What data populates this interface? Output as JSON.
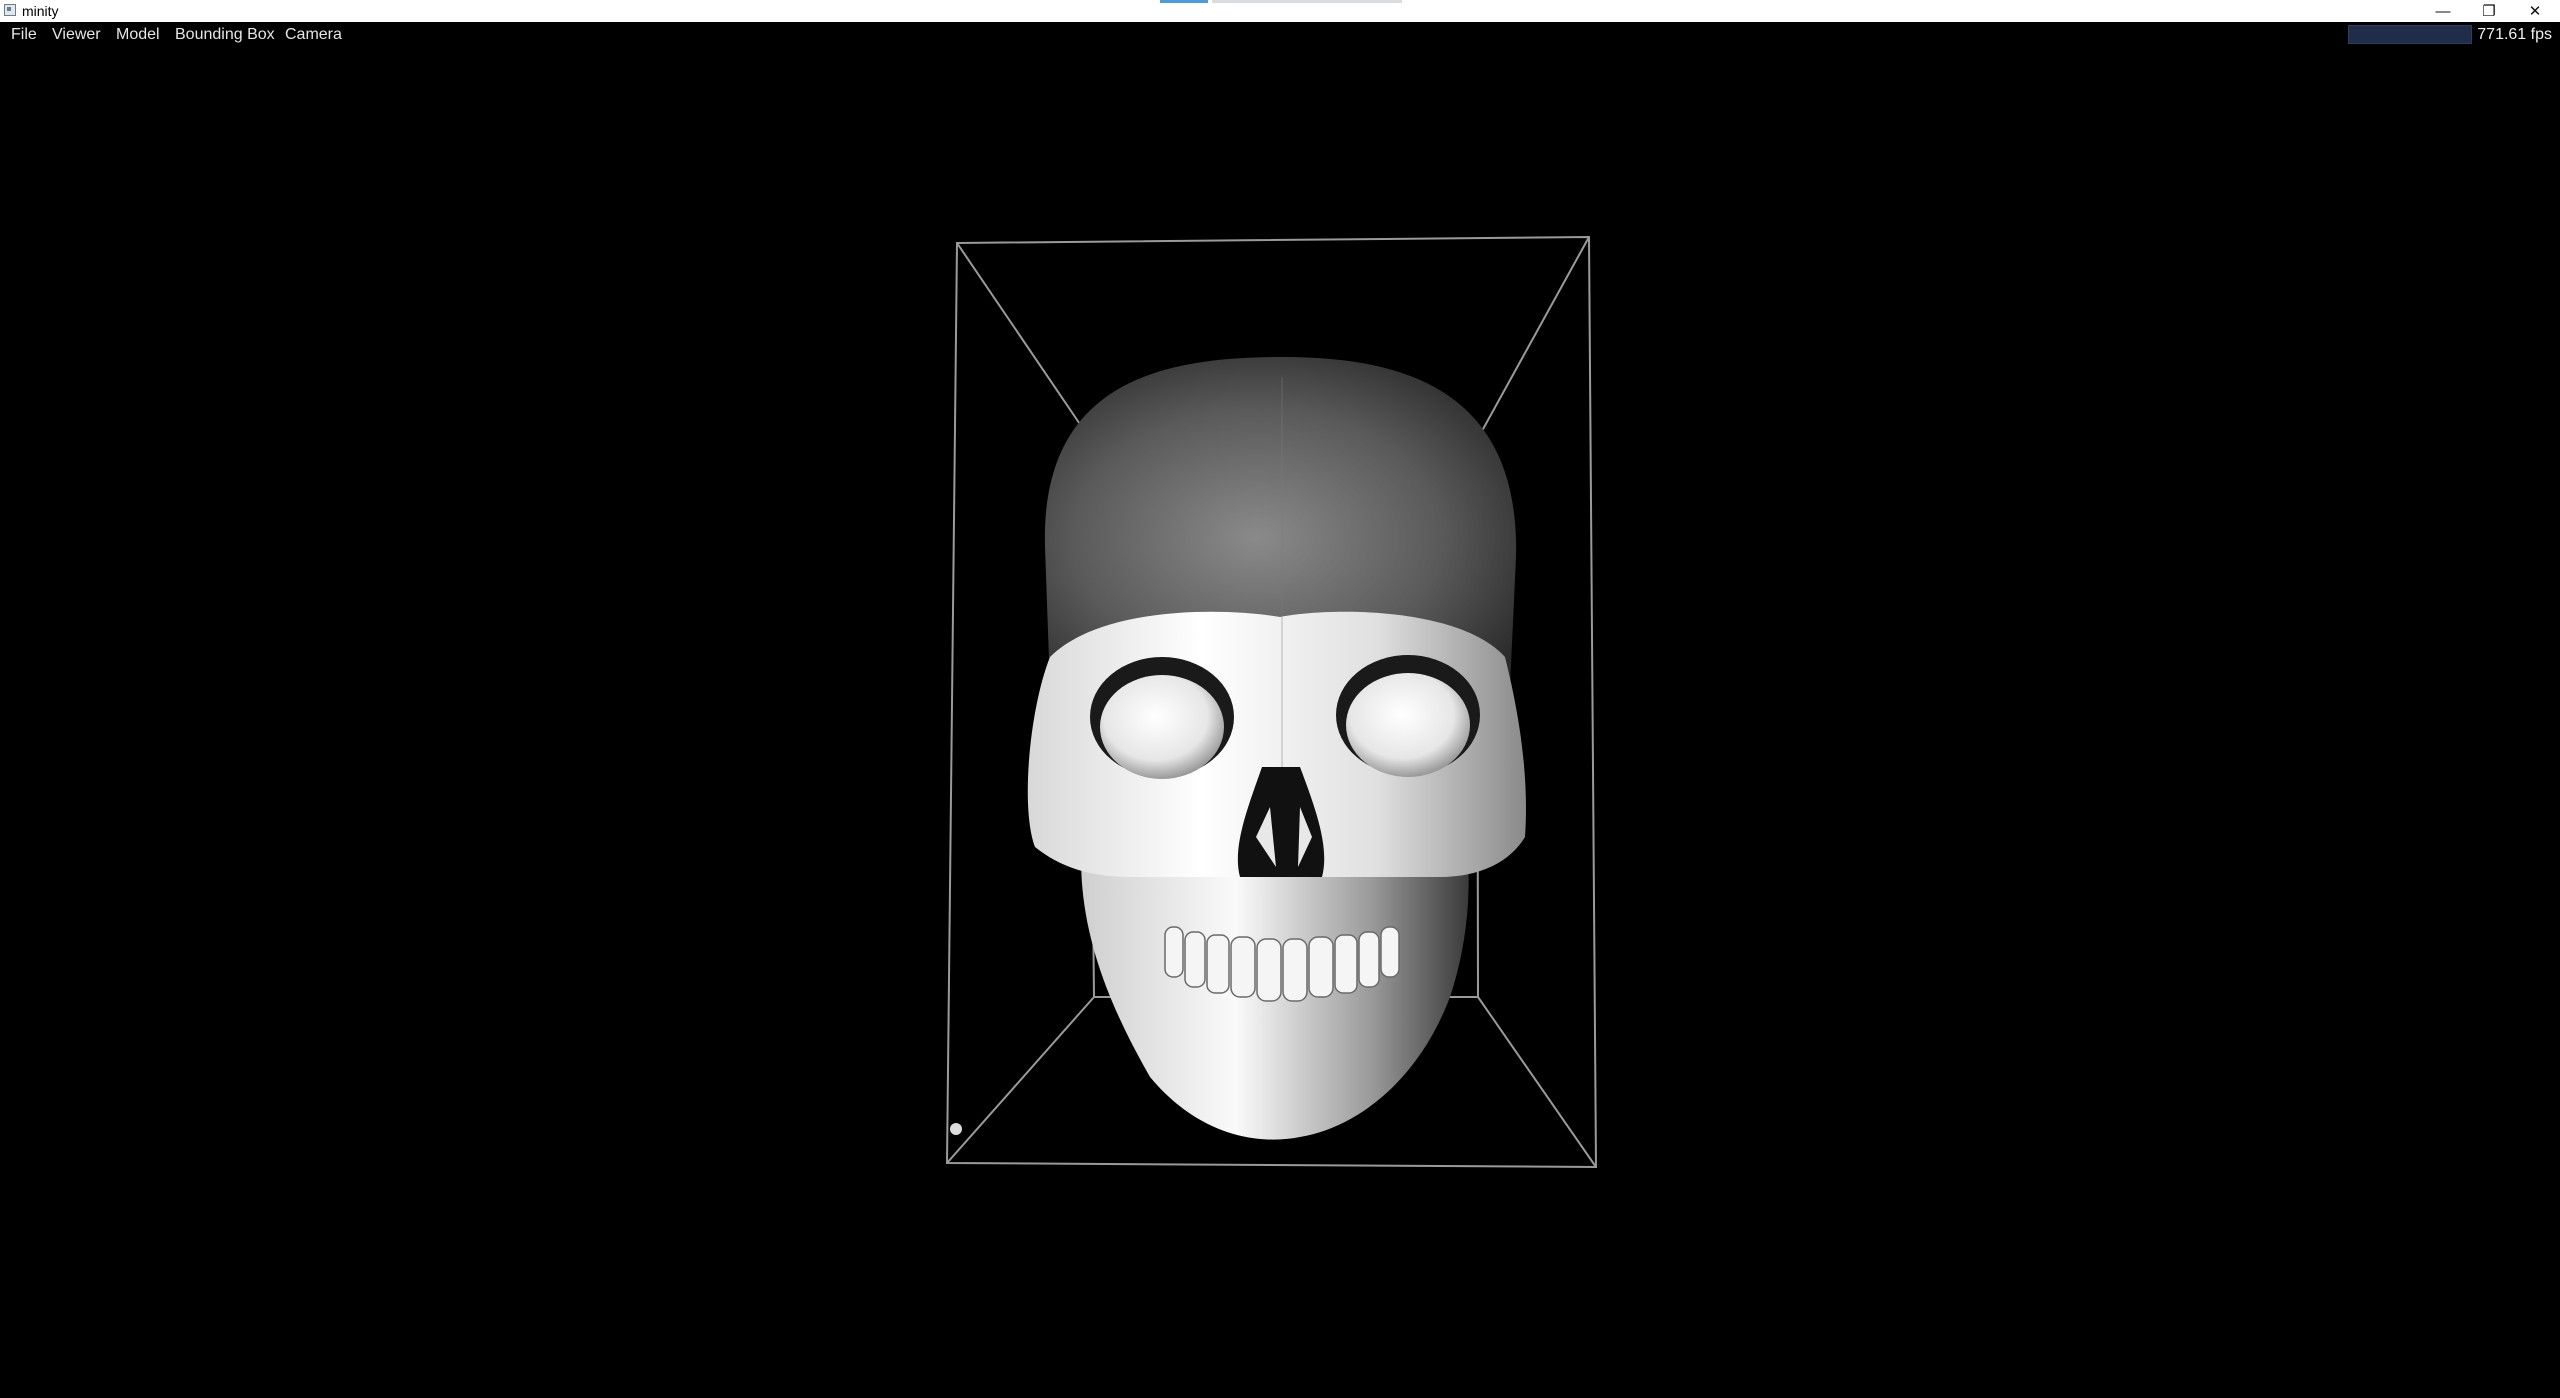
{
  "window": {
    "title": "minity",
    "controls": {
      "minimize": "—",
      "restore": "❐",
      "close": "✕"
    }
  },
  "menu": {
    "items": [
      {
        "label": "File"
      },
      {
        "label": "Viewer"
      },
      {
        "label": "Model"
      },
      {
        "label": "Bounding Box"
      },
      {
        "label": "Camera"
      }
    ]
  },
  "status": {
    "fps": "771.61 fps"
  },
  "colors": {
    "background": "#000000",
    "bounding_box": "#9a9a9a",
    "menu_text": "#e6e6e6"
  },
  "scene": {
    "model": "skull",
    "bounding_box_visible": true
  }
}
